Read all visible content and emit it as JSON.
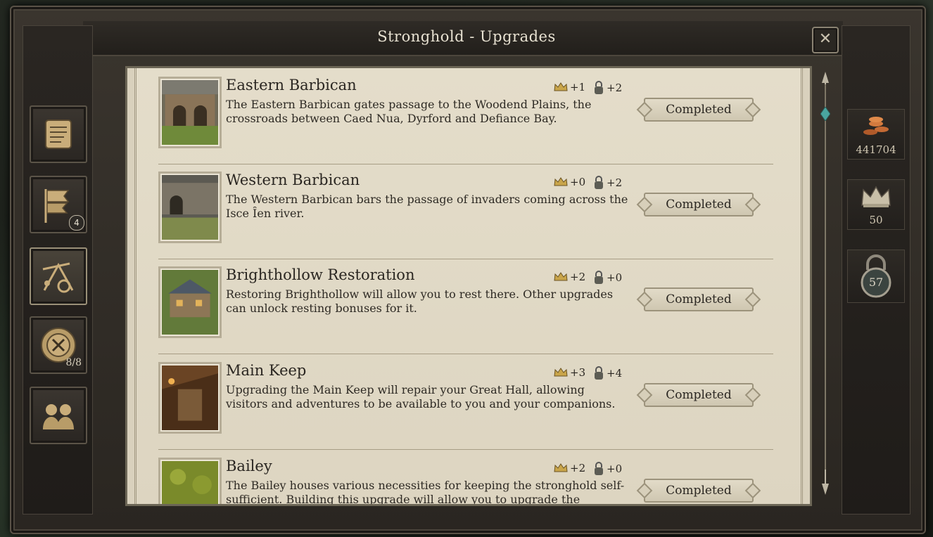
{
  "window": {
    "title": "Stronghold - Upgrades",
    "close_label": "✕"
  },
  "left_nav": {
    "items": [
      {
        "name": "overview",
        "icon": "scroll-icon"
      },
      {
        "name": "turns",
        "icon": "banners-icon",
        "badge": "4"
      },
      {
        "name": "upgrades",
        "icon": "siege-engine-icon",
        "active": true
      },
      {
        "name": "hirelings",
        "icon": "crest-coin-icon",
        "count": "8/8"
      },
      {
        "name": "companions",
        "icon": "people-icon"
      }
    ]
  },
  "resources": {
    "money": "441704",
    "prestige": "50",
    "security": "57"
  },
  "upgrades": [
    {
      "title": "Eastern Barbican",
      "prestige": "+1",
      "security": "+2",
      "description": "The Eastern Barbican gates passage to the Woodend Plains, the crossroads between Caed Nua, Dyrford and Defiance Bay.",
      "status": "Completed"
    },
    {
      "title": "Western Barbican",
      "prestige": "+0",
      "security": "+2",
      "description": "The Western Barbican bars the passage of invaders coming across the Isce Ȋen river.",
      "status": "Completed"
    },
    {
      "title": "Brighthollow Restoration",
      "prestige": "+2",
      "security": "+0",
      "description": "Restoring Brighthollow will allow you to rest there. Other upgrades can unlock resting bonuses for it.",
      "status": "Completed"
    },
    {
      "title": "Main Keep",
      "prestige": "+3",
      "security": "+4",
      "description": "Upgrading the Main Keep will repair your Great Hall, allowing visitors and adventures to be available to you and your companions.",
      "status": "Completed"
    },
    {
      "title": "Bailey",
      "prestige": "+2",
      "security": "+0",
      "description": "The Bailey houses various necessities for keeping the stronghold self-sufficient. Building this upgrade will allow you to upgrade the",
      "status": "Completed"
    }
  ]
}
